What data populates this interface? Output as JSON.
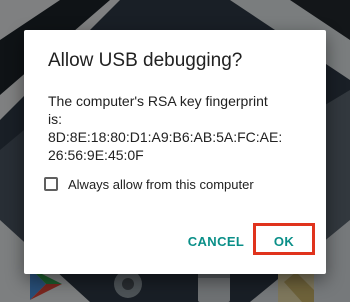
{
  "dialog": {
    "title": "Allow USB debugging?",
    "message_lines": [
      "The computer's RSA key fingerprint",
      "is:",
      "8D:8E:18:80:D1:A9:B6:AB:5A:FC:AE:",
      "26:56:9E:45:0F"
    ],
    "checkbox": {
      "label": "Always allow from this computer",
      "checked": false
    },
    "buttons": {
      "cancel": "CANCEL",
      "ok": "OK"
    }
  },
  "colors": {
    "accent": "#0a8f88",
    "highlight_border": "#e0331d",
    "dialog_background": "#ffffff",
    "text": "#212121"
  },
  "dock": {
    "icons": [
      "play-store-icon",
      "settings-icon",
      "files-icon",
      "maps-icon"
    ]
  }
}
